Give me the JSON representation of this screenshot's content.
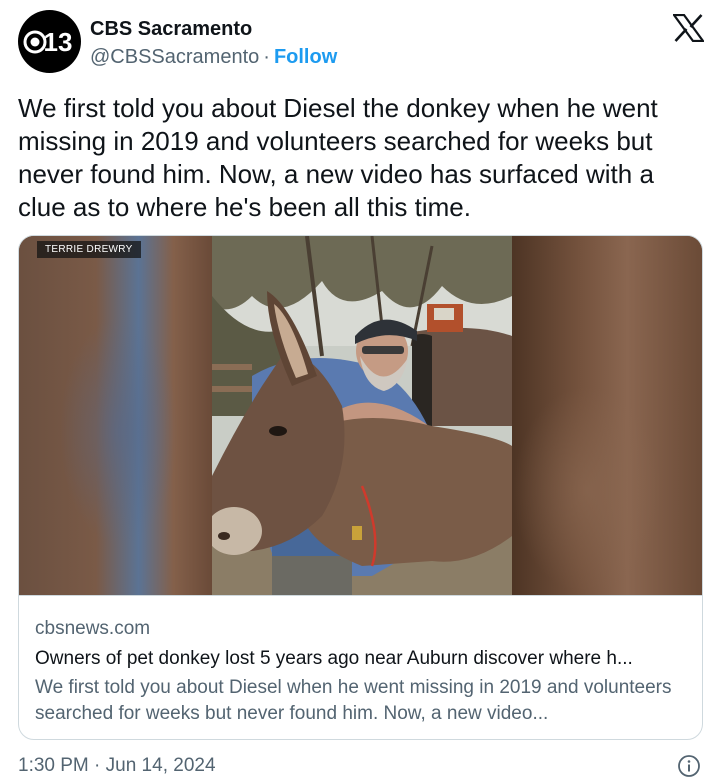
{
  "author": {
    "avatar_text": "13",
    "name": "CBS Sacramento",
    "handle": "@CBSSacramento",
    "separator": "·",
    "follow_label": "Follow"
  },
  "tweet": {
    "text": "We first told you about Diesel the donkey when he went missing in 2019 and volunteers searched for weeks but never found him. Now, a new video has surfaced with a clue as to where he's been all this time."
  },
  "card": {
    "photo_credit": "TERRIE DREWRY",
    "domain": "cbsnews.com",
    "title": "Owners of pet donkey lost 5 years ago near Auburn discover where h...",
    "description": "We first told you about Diesel when he went missing in 2019 and volunteers searched for weeks but never found him. Now, a new video..."
  },
  "footer": {
    "timestamp": "1:30 PM · Jun 14, 2024"
  },
  "icons": {
    "brand": "x-logo-icon",
    "info": "info-icon",
    "avatar": "cbs-eye-logo-icon"
  },
  "colors": {
    "link": "#1d9bf0",
    "secondary_text": "#536471",
    "border": "#cfd9de"
  }
}
